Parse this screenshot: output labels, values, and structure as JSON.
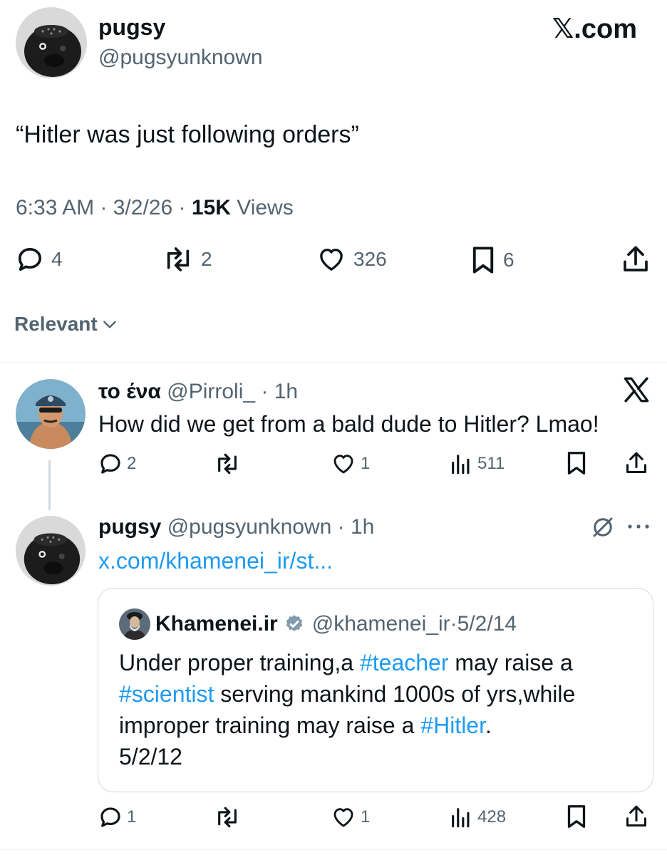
{
  "main_tweet": {
    "display_name": "pugsy",
    "handle": "@pugsyunknown",
    "brand": "𝕏.com",
    "text": "“Hitler was just following orders”",
    "time": "6:33 AM",
    "date": "3/2/26",
    "views_count": "15K",
    "views_label": "Views",
    "replies": "4",
    "reposts": "2",
    "likes": "326",
    "bookmarks": "6"
  },
  "sort": {
    "label": "Relevant"
  },
  "reply1": {
    "display_name": "το ένα",
    "handle": "@Pirroli_",
    "age": "1h",
    "text": "How did we get from a bald dude to Hitler? Lmao!",
    "replies": "2",
    "likes": "1",
    "views": "511"
  },
  "reply2": {
    "display_name": "pugsy",
    "handle": "@pugsyunknown",
    "age": "1h",
    "link": "x.com/khamenei_ir/st...",
    "replies": "1",
    "likes": "1",
    "views": "428"
  },
  "quote": {
    "display_name": "Khamenei.ir",
    "handle": "@khamenei_ir",
    "date": "5/2/14",
    "text_1": "Under proper training,a ",
    "tag_teacher": "#teacher",
    "text_2": " may raise a",
    "tag_scientist": "#scientist",
    "text_3": " serving mankind 1000s of yrs,while",
    "text_4": "improper training may raise a ",
    "tag_hitler": "#Hitler",
    "text_5": ".",
    "text_6": "5/2/12"
  },
  "colors": {
    "text": "#0f1419",
    "secondary": "#536471",
    "link": "#1d9bf0",
    "border": "#cfd9de"
  }
}
